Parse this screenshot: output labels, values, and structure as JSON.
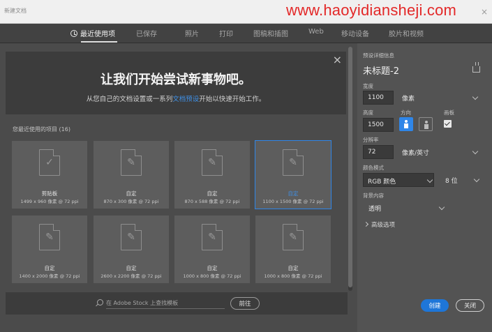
{
  "window": {
    "title": "新建文档",
    "watermark": "www.haoyidiansheji.com",
    "close": "×"
  },
  "tabs": [
    {
      "label": "最近使用项",
      "active": true
    },
    {
      "label": "已保存"
    },
    {
      "label": "照片"
    },
    {
      "label": "打印"
    },
    {
      "label": "图稿和插图"
    },
    {
      "label": "Web"
    },
    {
      "label": "移动设备"
    },
    {
      "label": "胶片和视频"
    }
  ],
  "banner": {
    "headline": "让我们开始尝试新事物吧。",
    "sub_before": "从您自己的文档设置或一系列",
    "sub_link": "文档预设",
    "sub_after": "开始以快速开始工作。",
    "close": "×"
  },
  "recent": {
    "label": "您最近使用的项目",
    "count": "(16)",
    "items": [
      {
        "name": "剪贴板",
        "dims": "1499 x 960 像素 @ 72 ppi",
        "icon": "clipboard-doc-icon",
        "selected": false
      },
      {
        "name": "自定",
        "dims": "870 x 300 像素 @ 72 ppi",
        "icon": "custom-doc-icon",
        "selected": false
      },
      {
        "name": "自定",
        "dims": "870 x 588 像素 @ 72 ppi",
        "icon": "custom-doc-icon",
        "selected": false
      },
      {
        "name": "自定",
        "dims": "1100 x 1500 像素 @ 72 ppi",
        "icon": "custom-doc-icon",
        "selected": true
      },
      {
        "name": "自定",
        "dims": "1400 x 2000 像素 @ 72 ppi",
        "icon": "custom-doc-icon",
        "selected": false
      },
      {
        "name": "自定",
        "dims": "2600 x 2200 像素 @ 72 ppi",
        "icon": "custom-doc-icon",
        "selected": false
      },
      {
        "name": "自定",
        "dims": "1000 x 800 像素 @ 72 ppi",
        "icon": "custom-doc-icon",
        "selected": false
      },
      {
        "name": "自定",
        "dims": "1000 x 800 像素 @ 72 ppi",
        "icon": "custom-doc-icon",
        "selected": false
      }
    ]
  },
  "search": {
    "placeholder": "在 Adobe Stock 上查找模板",
    "go_label": "前往"
  },
  "preset": {
    "section_label": "预设详细信息",
    "name": "未标题-2",
    "width_label": "宽度",
    "width_value": "1100",
    "width_unit": "像素",
    "height_label": "高度",
    "height_value": "1500",
    "orientation_label": "方向",
    "artboard_label": "画板",
    "artboard_checked": true,
    "resolution_label": "分辨率",
    "resolution_value": "72",
    "resolution_unit": "像素/英寸",
    "color_mode_label": "颜色模式",
    "color_mode_value": "RGB 颜色",
    "bit_depth_value": "8 位",
    "background_label": "背景内容",
    "background_value": "透明",
    "advanced_label": "高级选项"
  },
  "actions": {
    "create_label": "创建",
    "close_label": "关闭"
  },
  "colors": {
    "accent": "#2f86e8",
    "panel": "#535353",
    "watermark": "#e32828"
  }
}
